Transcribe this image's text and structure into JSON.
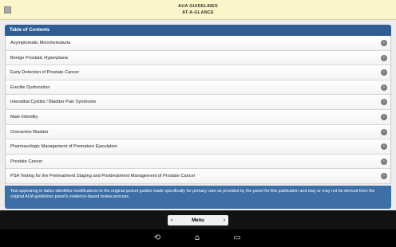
{
  "header": {
    "title_line1": "AUA GUIDELINES",
    "title_line2": "AT-A-GLANCE",
    "menu_icon": "square-icon"
  },
  "toc": {
    "heading": "Table of Contents",
    "items": [
      {
        "label": "Asymptomatic Microhematuria"
      },
      {
        "label": "Benign Prostatic Hyperplasia"
      },
      {
        "label": "Early Detection of Prostate Cancer"
      },
      {
        "label": "Erectile Dysfunction"
      },
      {
        "label": "Interstitial Cystitis / Bladder Pain Syndrome"
      },
      {
        "label": "Male Infertility"
      },
      {
        "label": "Overactive Bladder"
      },
      {
        "label": "Pharmacologic Management of Premature Ejaculation"
      },
      {
        "label": "Prostate Cancer"
      },
      {
        "label": "PSA Testing for the Pretreatment Staging and Posttreatment Management of Prostate Cancer"
      }
    ]
  },
  "note": {
    "text": "Text appearing in italics identifies modifications to the original pocket guides made specifically for primary care as provided by the panel for this publication and may or may not be derived from the original AUA guidelines panel's evidence-based review process."
  },
  "footer": {
    "menu_label": "Menu",
    "prev_icon": "chevron-left-icon",
    "next_icon": "chevron-right-icon"
  },
  "system_nav": {
    "icons": [
      "back-icon",
      "home-icon",
      "recent-apps-icon"
    ]
  },
  "colors": {
    "header_bg": "#fbf6c9",
    "toc_header_bg": "#2f5d93",
    "note_bg": "#3d6fa6",
    "footer_bg": "#121212"
  }
}
